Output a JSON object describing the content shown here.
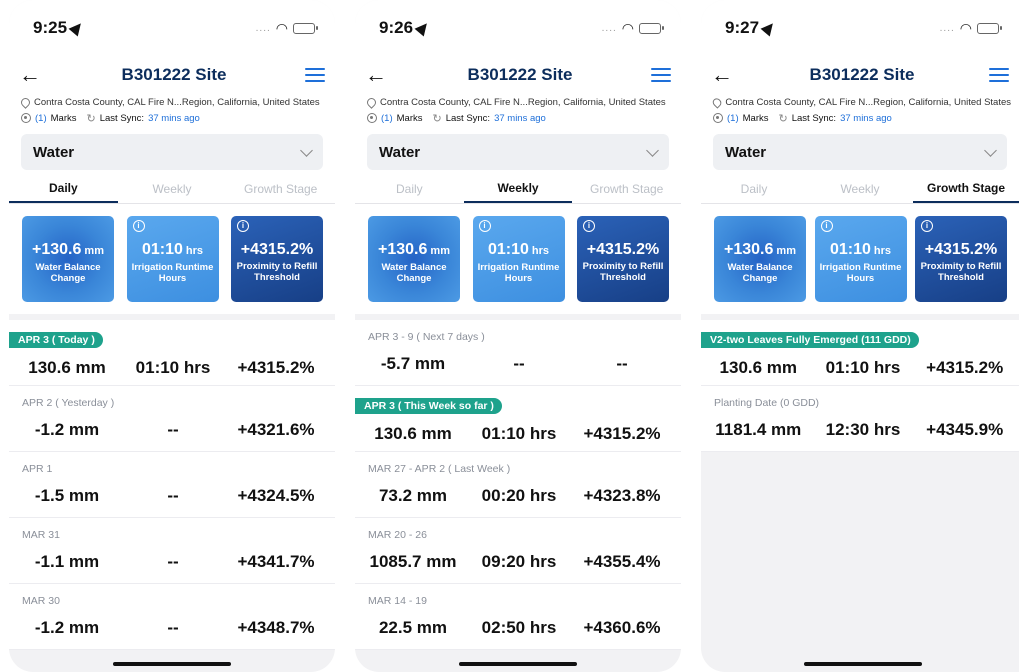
{
  "screens": [
    {
      "status": {
        "time": "9:25"
      },
      "header": {
        "title": "B301222 Site"
      },
      "location": "Contra Costa County, CAL Fire N...Region, California, United States",
      "marks": {
        "count": "(1)",
        "label": "Marks",
        "sync_label": "Last Sync:",
        "sync_time": "37 mins ago"
      },
      "dropdown": {
        "value": "Water"
      },
      "tabs": [
        {
          "label": "Daily"
        },
        {
          "label": "Weekly"
        },
        {
          "label": "Growth Stage"
        }
      ],
      "active_tab": 0,
      "cards": [
        {
          "value": "+130.6",
          "unit": "mm",
          "label": "Water Balance Change"
        },
        {
          "value": "01:10",
          "unit": "hrs",
          "label": "Irrigation Runtime Hours"
        },
        {
          "value": "+4315.2%",
          "unit": "",
          "label": "Proximity to Refill Threshold"
        }
      ],
      "rows": [
        {
          "label": "APR 3 ( Today )",
          "highlight": true,
          "water": "130.6 mm",
          "hours": "01:10 hrs",
          "proximity": "+4315.2%"
        },
        {
          "label": "APR 2 ( Yesterday )",
          "highlight": false,
          "water": "-1.2 mm",
          "hours": "--",
          "proximity": "+4321.6%"
        },
        {
          "label": "APR 1",
          "highlight": false,
          "water": "-1.5 mm",
          "hours": "--",
          "proximity": "+4324.5%"
        },
        {
          "label": "MAR 31",
          "highlight": false,
          "water": "-1.1 mm",
          "hours": "--",
          "proximity": "+4341.7%"
        },
        {
          "label": "MAR 30",
          "highlight": false,
          "water": "-1.2 mm",
          "hours": "--",
          "proximity": "+4348.7%"
        }
      ]
    },
    {
      "status": {
        "time": "9:26"
      },
      "header": {
        "title": "B301222 Site"
      },
      "location": "Contra Costa County, CAL Fire N...Region, California, United States",
      "marks": {
        "count": "(1)",
        "label": "Marks",
        "sync_label": "Last Sync:",
        "sync_time": "37 mins ago"
      },
      "dropdown": {
        "value": "Water"
      },
      "tabs": [
        {
          "label": "Daily"
        },
        {
          "label": "Weekly"
        },
        {
          "label": "Growth Stage"
        }
      ],
      "active_tab": 1,
      "cards": [
        {
          "value": "+130.6",
          "unit": "mm",
          "label": "Water Balance Change"
        },
        {
          "value": "01:10",
          "unit": "hrs",
          "label": "Irrigation Runtime Hours"
        },
        {
          "value": "+4315.2%",
          "unit": "",
          "label": "Proximity to Refill Threshold"
        }
      ],
      "rows": [
        {
          "label": "APR 3 - 9 ( Next 7 days )",
          "highlight": false,
          "water": "-5.7 mm",
          "hours": "--",
          "proximity": "--"
        },
        {
          "label": "APR 3 ( This Week so far )",
          "highlight": true,
          "water": "130.6 mm",
          "hours": "01:10 hrs",
          "proximity": "+4315.2%"
        },
        {
          "label": "MAR 27 - APR 2 ( Last Week )",
          "highlight": false,
          "water": "73.2 mm",
          "hours": "00:20 hrs",
          "proximity": "+4323.8%"
        },
        {
          "label": "MAR 20 - 26",
          "highlight": false,
          "water": "1085.7 mm",
          "hours": "09:20 hrs",
          "proximity": "+4355.4%"
        },
        {
          "label": "MAR 14 - 19",
          "highlight": false,
          "water": "22.5 mm",
          "hours": "02:50 hrs",
          "proximity": "+4360.6%"
        }
      ]
    },
    {
      "status": {
        "time": "9:27"
      },
      "header": {
        "title": "B301222 Site"
      },
      "location": "Contra Costa County, CAL Fire N...Region, California, United States",
      "marks": {
        "count": "(1)",
        "label": "Marks",
        "sync_label": "Last Sync:",
        "sync_time": "37 mins ago"
      },
      "dropdown": {
        "value": "Water"
      },
      "tabs": [
        {
          "label": "Daily"
        },
        {
          "label": "Weekly"
        },
        {
          "label": "Growth Stage"
        }
      ],
      "active_tab": 2,
      "cards": [
        {
          "value": "+130.6",
          "unit": "mm",
          "label": "Water Balance Change"
        },
        {
          "value": "01:10",
          "unit": "hrs",
          "label": "Irrigation Runtime Hours"
        },
        {
          "value": "+4315.2%",
          "unit": "",
          "label": "Proximity to Refill Threshold"
        }
      ],
      "rows": [
        {
          "label": "V2-two Leaves Fully Emerged (111 GDD)",
          "highlight": true,
          "water": "130.6 mm",
          "hours": "01:10 hrs",
          "proximity": "+4315.2%"
        },
        {
          "label": "Planting Date (0 GDD)",
          "highlight": false,
          "water": "1181.4 mm",
          "hours": "12:30 hrs",
          "proximity": "+4345.9%"
        }
      ]
    }
  ]
}
